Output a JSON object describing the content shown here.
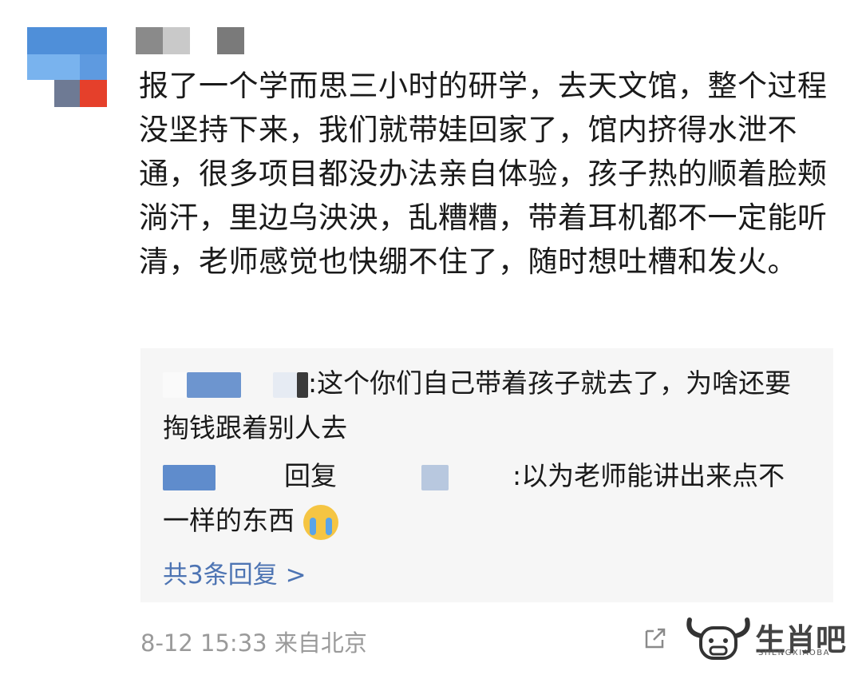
{
  "post": {
    "text": "报了一个学而思三小时的研学，去天文馆，整个过程没坚持下来，我们就带娃回家了，馆内挤得水泄不通，很多项目都没办法亲自体验，孩子热的顺着脸颊淌汗，里边乌泱泱，乱糟糟，带着耳机都不一定能听清，老师感觉也快绷不住了，随时想吐槽和发火。"
  },
  "replies": {
    "reply1_text": ":这个你们自己带着孩子就去了，为啥还要掏钱跟着别人去",
    "reply2_prefix": "回复",
    "reply2_text": ":以为老师能讲出来点不一样的东西",
    "more_label": "共3条回复 >"
  },
  "footer": {
    "timestamp": "8-12 15:33",
    "location": "来自北京"
  },
  "watermark": {
    "text": "生肖吧",
    "sub": "SHENGXIAOBA"
  },
  "icons": {
    "share": "share-icon",
    "crying": "crying-face-emoji",
    "logo": "ox-logo-icon"
  }
}
